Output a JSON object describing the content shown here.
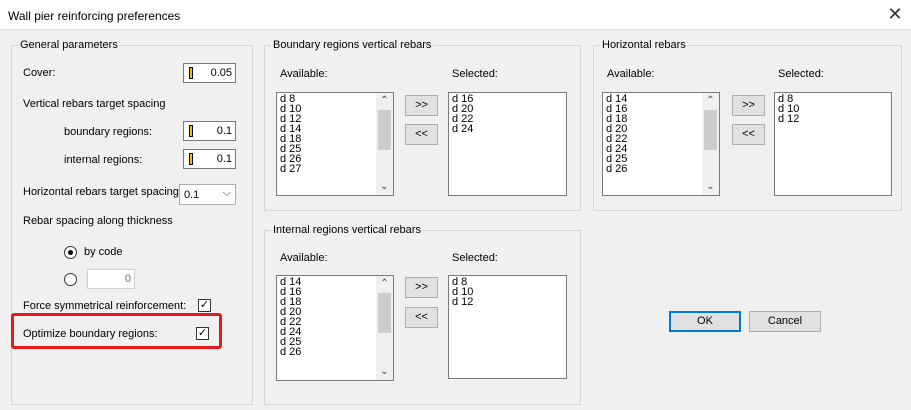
{
  "window": {
    "title": "Wall pier reinforcing preferences",
    "close_glyph": "✕"
  },
  "general": {
    "legend": "General parameters",
    "cover_label": "Cover:",
    "cover_value": "0.05",
    "vertical_spacing_label": "Vertical rebars target spacing",
    "boundary_label": "boundary regions:",
    "boundary_value": "0.1",
    "internal_label": "internal regions:",
    "internal_value": "0.1",
    "horizontal_spacing_label": "Horizontal rebars target spacing:",
    "horizontal_spacing_value": "0.1",
    "thickness_label": "Rebar spacing along thickness",
    "by_code_label": "by code",
    "custom_value": "0",
    "force_sym_label": "Force symmetrical reinforcement:",
    "force_sym_checked": true,
    "optimize_label": "Optimize boundary regions:",
    "optimize_checked": true,
    "highlight_color": "#e8191c"
  },
  "boundary_vertical": {
    "legend": "Boundary regions vertical rebars",
    "available_label": "Available:",
    "selected_label": "Selected:",
    "available": [
      "d 8",
      "d 10",
      "d 12",
      "d 14",
      "d 18",
      "d 25",
      "d 26",
      "d 27"
    ],
    "selected": [
      "d 16",
      "d 20",
      "d 22",
      "d 24"
    ],
    "add_label": ">>",
    "remove_label": "<<"
  },
  "horizontal": {
    "legend": "Horizontal rebars",
    "available_label": "Available:",
    "selected_label": "Selected:",
    "available": [
      "d 14",
      "d 16",
      "d 18",
      "d 20",
      "d 22",
      "d 24",
      "d 25",
      "d 26"
    ],
    "selected": [
      "d 8",
      "d 10",
      "d 12"
    ],
    "add_label": ">>",
    "remove_label": "<<"
  },
  "internal_vertical": {
    "legend": "Internal regions vertical rebars",
    "available_label": "Available:",
    "selected_label": "Selected:",
    "available": [
      "d 14",
      "d 16",
      "d 18",
      "d 20",
      "d 22",
      "d 24",
      "d 25",
      "d 26"
    ],
    "selected": [
      "d 8",
      "d 10",
      "d 12"
    ],
    "add_label": ">>",
    "remove_label": "<<"
  },
  "buttons": {
    "ok_label": "OK",
    "cancel_label": "Cancel"
  }
}
